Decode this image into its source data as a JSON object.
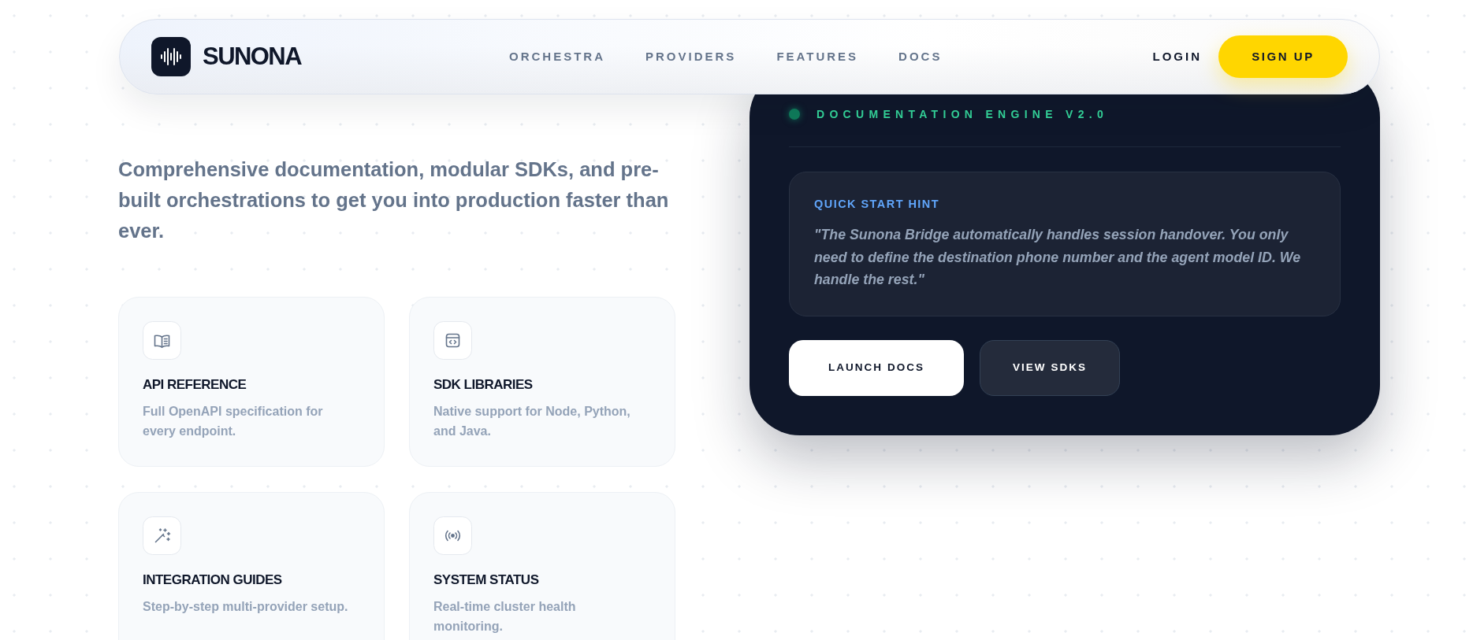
{
  "navbar": {
    "brand": "SUNONA",
    "links": [
      "ORCHESTRA",
      "PROVIDERS",
      "FEATURES",
      "DOCS"
    ],
    "login": "LOGIN",
    "signup": "SIGN UP"
  },
  "hero": {
    "description": "Comprehensive documentation, modular SDKs, and pre-built orchestrations to get you into production faster than ever.",
    "cards": [
      {
        "title": "API REFERENCE",
        "description": "Full OpenAPI specification for every endpoint."
      },
      {
        "title": "SDK LIBRARIES",
        "description": "Native support for Node, Python, and Java."
      },
      {
        "title": "INTEGRATION GUIDES",
        "description": "Step-by-step multi-provider setup."
      },
      {
        "title": "SYSTEM STATUS",
        "description": "Real-time cluster health monitoring."
      }
    ]
  },
  "panel": {
    "status_label": "DOCUMENTATION ENGINE V2.0",
    "hint": {
      "title": "QUICK START HINT",
      "text": "\"The Sunona Bridge automatically handles session handover. You only need to define the destination phone number and the agent model ID. We handle the rest.\""
    },
    "buttons": [
      {
        "label": "LAUNCH DOCS",
        "kind": "primary"
      },
      {
        "label": "VIEW SDKS",
        "kind": "secondary"
      }
    ]
  }
}
